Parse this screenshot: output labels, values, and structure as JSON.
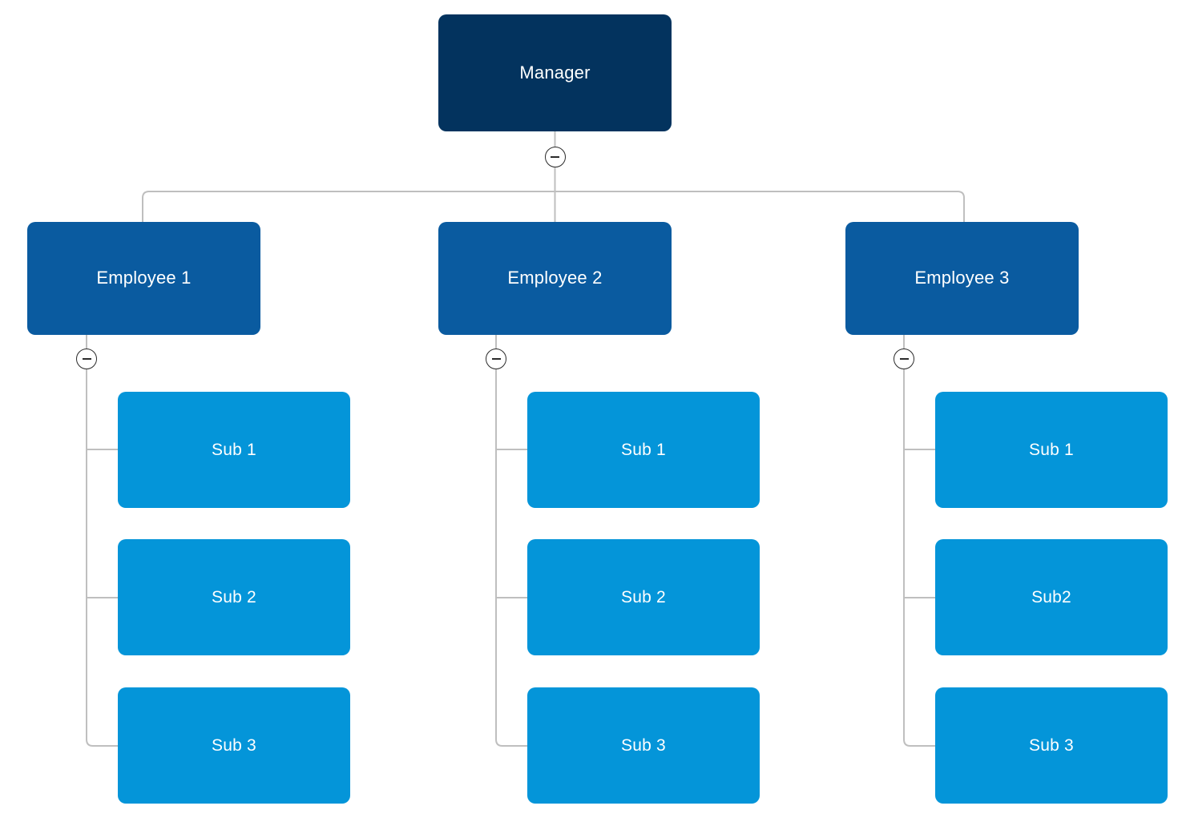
{
  "chart": {
    "type": "org-chart",
    "title": "",
    "connector_color": "#BFBFBF",
    "levels": [
      {
        "name": "root",
        "color": "#03335E"
      },
      {
        "name": "employees",
        "color": "#0A5BA0"
      },
      {
        "name": "subordinates",
        "color": "#0495D9"
      }
    ]
  },
  "root": {
    "label": "Manager",
    "toggle": {
      "icon": "minus-circle-icon",
      "state": "expanded"
    }
  },
  "employees": [
    {
      "label": "Employee 1",
      "toggle": {
        "icon": "minus-circle-icon",
        "state": "expanded"
      },
      "children": [
        {
          "label": "Sub 1"
        },
        {
          "label": "Sub 2"
        },
        {
          "label": "Sub 3"
        }
      ]
    },
    {
      "label": "Employee 2",
      "toggle": {
        "icon": "minus-circle-icon",
        "state": "expanded"
      },
      "children": [
        {
          "label": "Sub 1"
        },
        {
          "label": "Sub 2"
        },
        {
          "label": "Sub 3"
        }
      ]
    },
    {
      "label": "Employee 3",
      "toggle": {
        "icon": "minus-circle-icon",
        "state": "expanded"
      },
      "children": [
        {
          "label": "Sub 1"
        },
        {
          "label": "Sub2"
        },
        {
          "label": "Sub 3"
        }
      ]
    }
  ]
}
